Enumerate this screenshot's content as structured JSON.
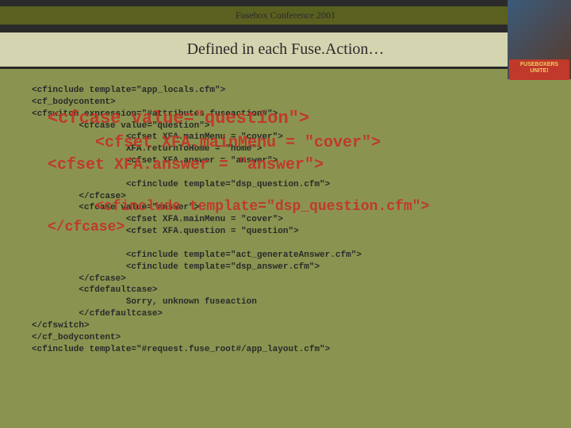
{
  "header": {
    "conference": "Fusebox Conference 2001"
  },
  "title": "Defined in each Fuse.Action…",
  "sidebar": {
    "logo_line1": "FUSEBOXERS",
    "logo_line2": "UNITE!"
  },
  "code": {
    "lines": "<cfinclude template=\"app_locals.cfm\">\n<cf_bodycontent>\n<cfswitch expression=\"#attributes.fuseaction#\">\n         <cfcase value=\"question\">\n                  <cfset XFA.mainMenu = \"cover\">\n                  XFA.returnToHome = \"home\">\n                  <cfset XFA.answer = \"answer\">\n\n                  <cfinclude template=\"dsp_question.cfm\">\n         </cfcase>\n         <cfcase value=\"answer\">\n                  <cfset XFA.mainMenu = \"cover\">\n                  <cfset XFA.question = \"question\">\n\n                  <cfinclude template=\"act_generateAnswer.cfm\">\n                  <cfinclude template=\"dsp_answer.cfm\">\n         </cfcase>\n         <cfdefaultcase>\n                  Sorry, unknown fuseaction\n         </cfdefaultcase>\n</cfswitch>\n</cf_bodycontent>\n<cfinclude template=\"#request.fuse_root#/app_layout.cfm\">"
  },
  "overlay": {
    "line1": "<cfcase value=\"question\">",
    "line2": "<cfset XFA.mainMenu = \"cover\">",
    "line3": "<cfset XFA.answer = \"answer\">",
    "line4": "<cfinclude template=\"dsp_question.cfm\">",
    "line5": "</cfcase>"
  }
}
